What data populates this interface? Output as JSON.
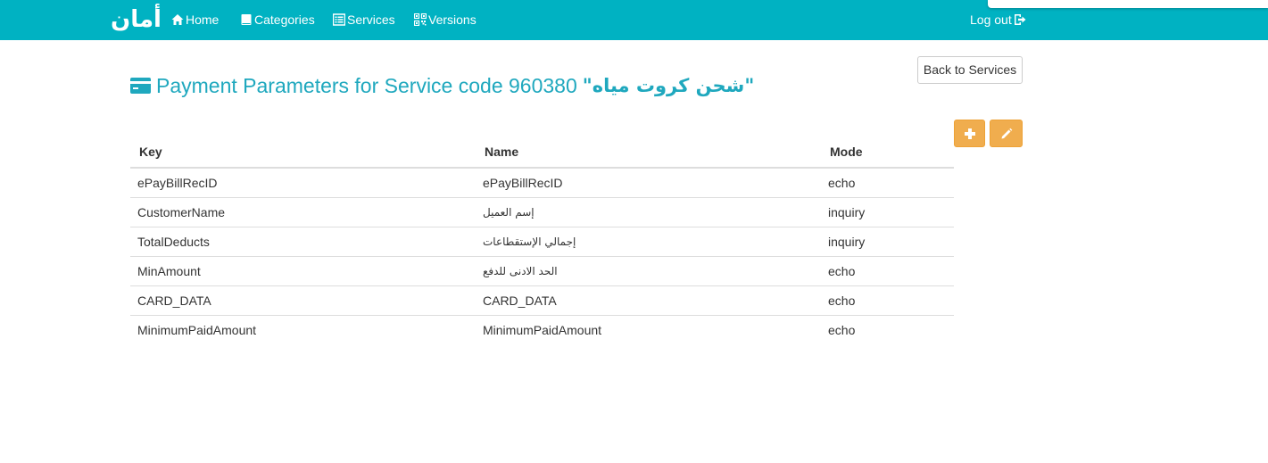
{
  "brand": {
    "logo_text": "أمان",
    "color": "#00b2c2"
  },
  "nav": {
    "home": "Home",
    "categories": "Categories",
    "services": "Services",
    "versions": "Versions",
    "logout": "Log out"
  },
  "page": {
    "title_prefix": "Payment Parameters for Service code 960380",
    "title_service_name": "\"شحن كروت مياه\"",
    "back_button": "Back to Services"
  },
  "table": {
    "headers": {
      "key": "Key",
      "name": "Name",
      "mode": "Mode"
    },
    "rows": [
      {
        "key": "ePayBillRecID",
        "name": "ePayBillRecID",
        "mode": "echo"
      },
      {
        "key": "CustomerName",
        "name": "إسم العميل",
        "mode": "inquiry"
      },
      {
        "key": "TotalDeducts",
        "name": "إجمالي الإستقطاعات",
        "mode": "inquiry"
      },
      {
        "key": "MinAmount",
        "name": "الحد الادنى للدفع",
        "mode": "echo"
      },
      {
        "key": "CARD_DATA",
        "name": "CARD_DATA",
        "mode": "echo"
      },
      {
        "key": "MinimumPaidAmount",
        "name": "MinimumPaidAmount",
        "mode": "echo"
      }
    ]
  },
  "icons": {
    "home": "home-icon",
    "categories": "book-icon",
    "services": "list-icon",
    "versions": "qrcode-icon",
    "logout": "log-out-icon",
    "title": "credit-card-icon",
    "add": "plus-icon",
    "edit": "pencil-icon"
  },
  "colors": {
    "accent": "#00b2c2",
    "title": "#1fa8be",
    "warning": "#f0ad4e"
  }
}
